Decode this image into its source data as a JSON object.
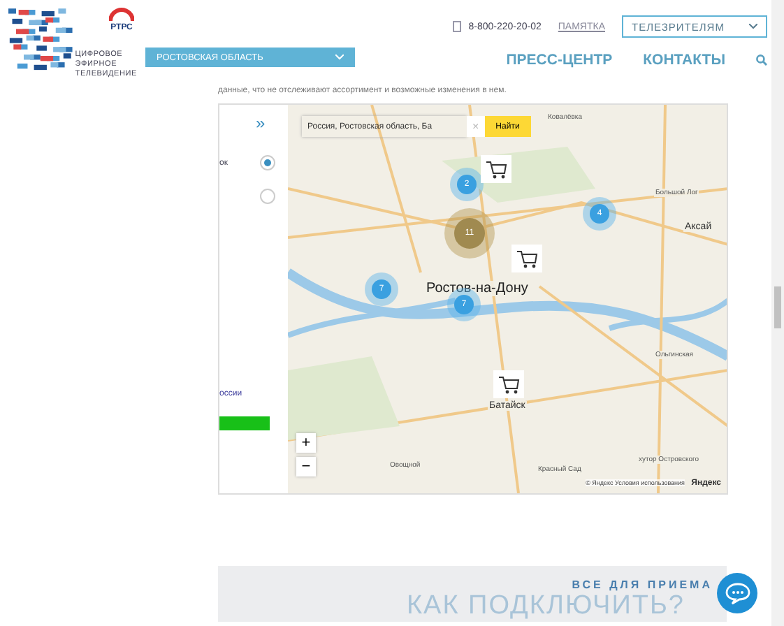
{
  "header": {
    "logo_text": [
      "ЦИФРОВОЕ",
      "ЭФИРНОЕ",
      "ТЕЛЕВИДЕНИЕ"
    ],
    "badge": "РТРС",
    "region": "РОСТОВСКАЯ ОБЛАСТЬ",
    "phone": "8-800-220-20-02",
    "memo_link": "ПАМЯТКА",
    "audience": "ТЕЛЕЗРИТЕЛЯМ",
    "nav": [
      "ПРЕСС-ЦЕНТР",
      "КОНТАКТЫ"
    ]
  },
  "intro_text": "данные, что не отслеживают ассортимент и возможные изменения в нем.",
  "side_panel": {
    "expand": "»",
    "options": [
      {
        "label": "ок",
        "selected": true
      },
      {
        "selected": false
      }
    ],
    "caption": "оссии"
  },
  "map": {
    "search": {
      "value": "Россия, Ростовская область, Ба",
      "clear": "×",
      "button": "Найти"
    },
    "labels": [
      {
        "text": "Ковалёвка",
        "kind": "small"
      },
      {
        "text": "Большой Лог",
        "kind": "small"
      },
      {
        "text": "Аксай",
        "kind": "town"
      },
      {
        "text": "Ростов-на-Дону",
        "kind": "city"
      },
      {
        "text": "Батайск",
        "kind": "town"
      },
      {
        "text": "Ольгинская",
        "kind": "small"
      },
      {
        "text": "хутор Островского",
        "kind": "small"
      },
      {
        "text": "Овощной",
        "kind": "small"
      },
      {
        "text": "Красный Сад",
        "kind": "small"
      }
    ],
    "clusters": [
      {
        "count": "2",
        "kind": "small"
      },
      {
        "count": "11",
        "kind": "large"
      },
      {
        "count": "4",
        "kind": "small"
      },
      {
        "count": "7",
        "kind": "small"
      },
      {
        "count": "7",
        "kind": "small"
      }
    ],
    "zoom": [
      "+",
      "−"
    ],
    "copyright": "© Яндекс Условия использования",
    "brand": "Яндекс"
  },
  "banner": {
    "subtitle": "ВСЕ ДЛЯ ПРИЕМА",
    "title": "КАК ПОДКЛЮЧИТЬ?"
  }
}
